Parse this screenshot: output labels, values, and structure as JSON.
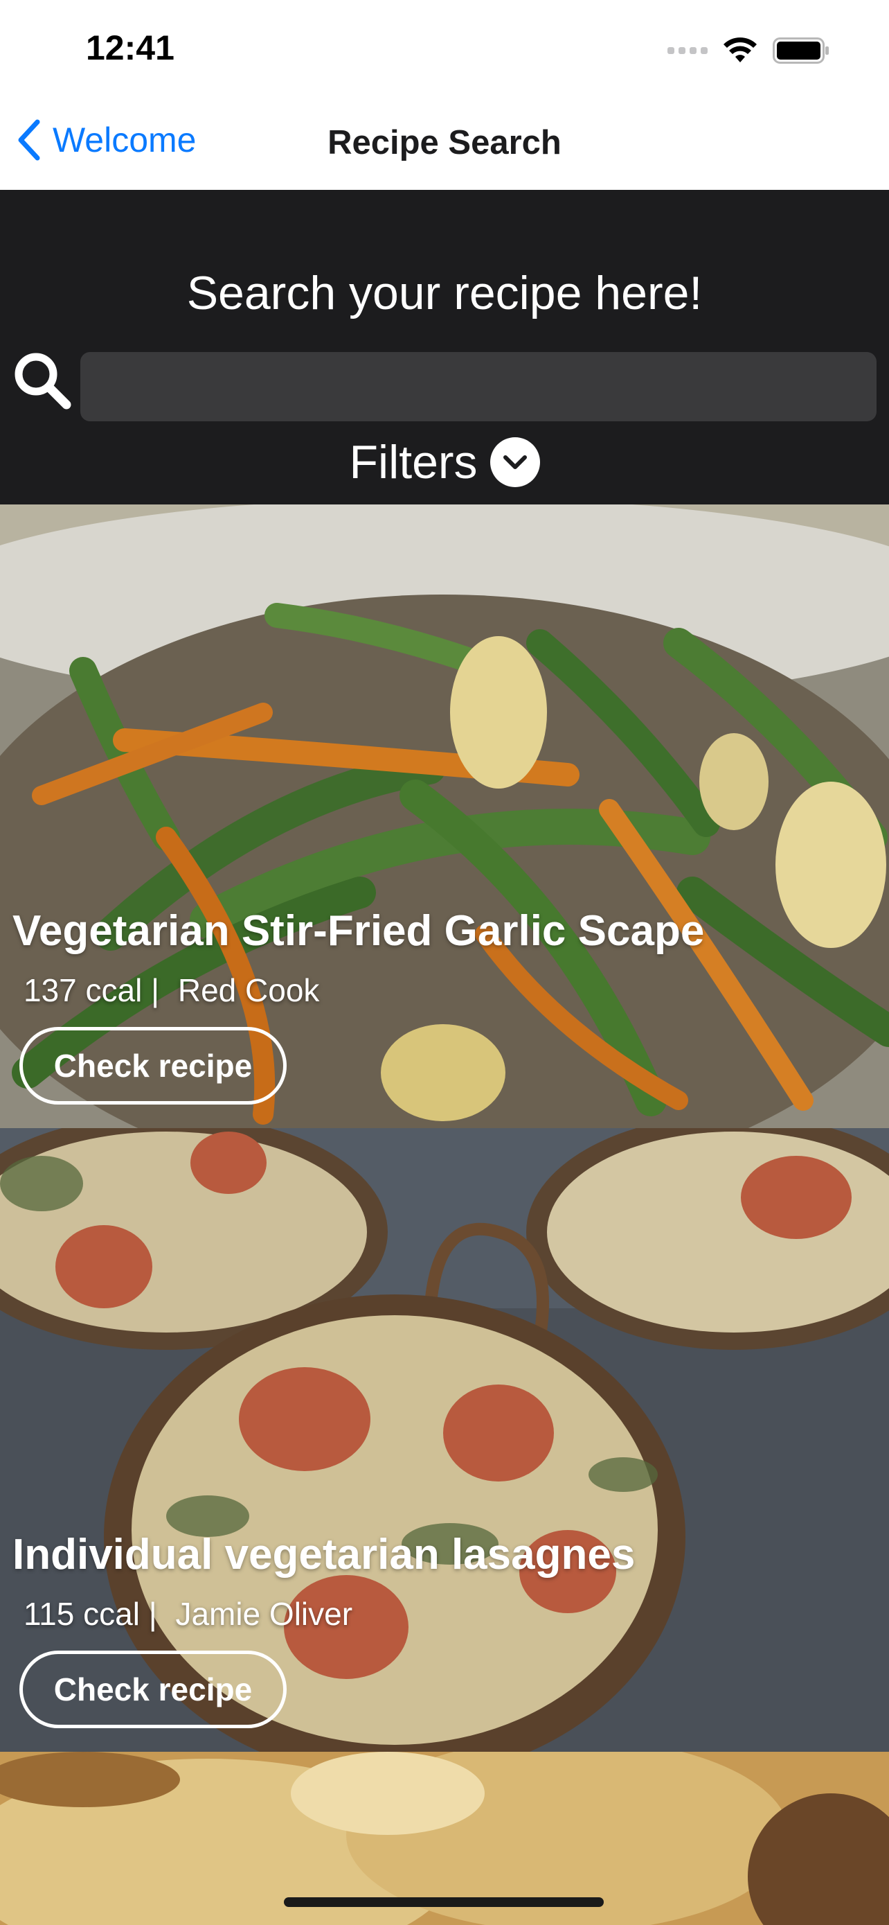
{
  "status_bar": {
    "time": "12:41"
  },
  "nav": {
    "back_label": "Welcome",
    "title": "Recipe Search"
  },
  "search": {
    "heading": "Search your recipe here!",
    "placeholder": "",
    "value": ""
  },
  "filters": {
    "label": "Filters"
  },
  "recipes": [
    {
      "title": "Vegetarian Stir-Fried Garlic Scape",
      "calories": "137 ccal |",
      "source": "Red Cook",
      "button": "Check recipe"
    },
    {
      "title": "Individual vegetarian lasagnes",
      "calories": "115 ccal |",
      "source": "Jamie Oliver",
      "button": "Check recipe"
    }
  ],
  "icons": {
    "back": "chevron-left-icon",
    "search": "magnifier-icon",
    "filters": "chevron-down-circle-icon"
  },
  "colors": {
    "link": "#0a7aff",
    "header_bg": "#1c1c1e",
    "field_bg": "#3a3a3c"
  }
}
